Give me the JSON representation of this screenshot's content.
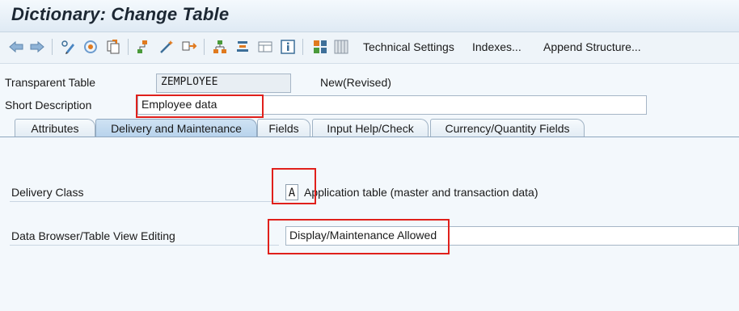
{
  "window": {
    "title": "Dictionary: Change Table"
  },
  "toolbar": {
    "icons": [
      "back-arrow-icon",
      "forward-arrow-icon",
      "display-change-icon",
      "activate-icon",
      "copy-object-icon",
      "hierarchy-icon",
      "magic-wand-icon",
      "where-used-icon",
      "object-list-icon",
      "navigation-stack-icon",
      "graphics-icon",
      "info-icon",
      "grid-icon",
      "table-icon"
    ],
    "technical_settings": "Technical Settings",
    "indexes": "Indexes...",
    "append_structure": "Append Structure..."
  },
  "header": {
    "table_type_label": "Transparent Table",
    "table_name": "ZEMPLOYEE",
    "status": "New(Revised)",
    "short_desc_label": "Short Description",
    "short_desc_value": "Employee data"
  },
  "tabs": [
    {
      "label": "Attributes",
      "active": false
    },
    {
      "label": "Delivery and Maintenance",
      "active": true
    },
    {
      "label": "Fields",
      "active": false
    },
    {
      "label": "Input Help/Check",
      "active": false
    },
    {
      "label": "Currency/Quantity Fields",
      "active": false
    }
  ],
  "delivery": {
    "delivery_class_label": "Delivery Class",
    "delivery_class_value": "A",
    "delivery_class_text": "Application table (master and transaction data)",
    "browser_label": "Data Browser/Table View Editing",
    "browser_value": "Display/Maintenance Allowed"
  },
  "colors": {
    "highlight": "#e0201b",
    "active_tab": "#b8d3ec",
    "panel_bg": "#f3f8fc"
  }
}
